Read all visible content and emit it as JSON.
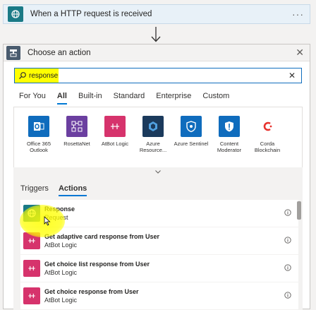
{
  "trigger": {
    "title": "When a HTTP request is received",
    "more": "···"
  },
  "panel": {
    "title": "Choose an action",
    "close": "✕"
  },
  "search": {
    "value": "response",
    "clear": "✕"
  },
  "category_tabs": [
    {
      "label": "For You",
      "active": false
    },
    {
      "label": "All",
      "active": true
    },
    {
      "label": "Built-in",
      "active": false
    },
    {
      "label": "Standard",
      "active": false
    },
    {
      "label": "Enterprise",
      "active": false
    },
    {
      "label": "Custom",
      "active": false
    }
  ],
  "connectors": [
    {
      "label": "Office 365 Outlook",
      "color": "#0f6cbd",
      "icon": "outlook-icon"
    },
    {
      "label": "RosettaNet",
      "color": "#6b3fa0",
      "icon": "rosettanet-icon"
    },
    {
      "label": "AtBot Logic",
      "color": "#d6336c",
      "icon": "atbot-icon"
    },
    {
      "label": "Azure Resource...",
      "color": "#1b3a5c",
      "icon": "azure-resource-icon"
    },
    {
      "label": "Azure Sentinel",
      "color": "#0f6cbd",
      "icon": "sentinel-icon"
    },
    {
      "label": "Content Moderator",
      "color": "#0f6cbd",
      "icon": "content-moderator-icon"
    },
    {
      "label": "Corda Blockchain",
      "color": "#ffffff",
      "icon": "corda-icon"
    }
  ],
  "sub_tabs": [
    {
      "label": "Triggers",
      "active": false
    },
    {
      "label": "Actions",
      "active": true
    }
  ],
  "actions": [
    {
      "title": "Response",
      "subtitle": "Request",
      "color": "#1a7a86",
      "icon": "globe-icon"
    },
    {
      "title": "Get adaptive card response from User",
      "subtitle": "AtBot Logic",
      "color": "#d6336c",
      "icon": "atbot-icon"
    },
    {
      "title": "Get choice list response from User",
      "subtitle": "AtBot Logic",
      "color": "#d6336c",
      "icon": "atbot-icon"
    },
    {
      "title": "Get choice response from User",
      "subtitle": "AtBot Logic",
      "color": "#d6336c",
      "icon": "atbot-icon"
    }
  ]
}
